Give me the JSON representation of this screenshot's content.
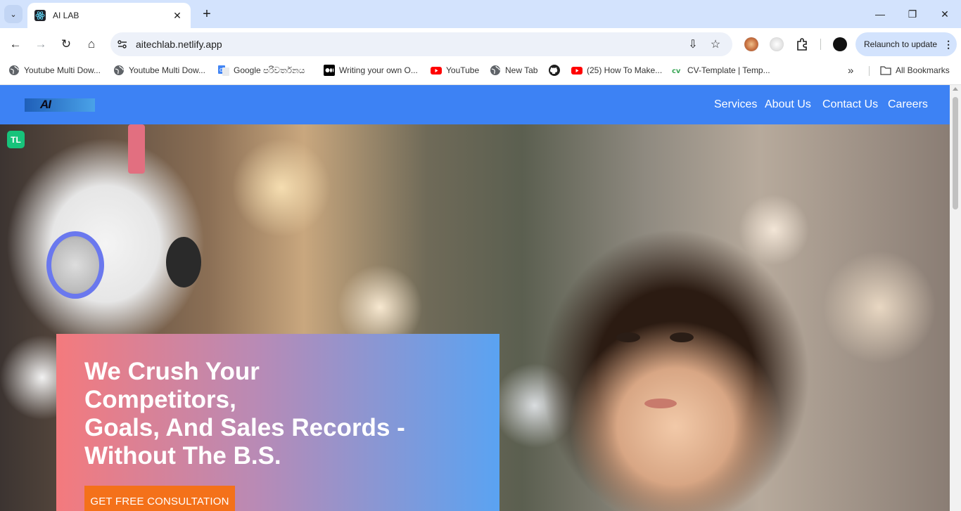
{
  "browser": {
    "tab": {
      "title": "AI LAB",
      "close_glyph": "✕",
      "favicon": "react-atom-icon"
    },
    "new_tab_glyph": "+",
    "tab_search_glyph": "⌄",
    "window": {
      "minimize": "—",
      "restore": "❐",
      "close": "✕"
    },
    "nav": {
      "back": "←",
      "forward": "→",
      "reload": "↻",
      "home": "⌂"
    },
    "address": {
      "url": "aitechlab.netlify.app"
    },
    "omnibox_icons": {
      "install": "⇩",
      "bookmark": "☆"
    },
    "relaunch": {
      "label": "Relaunch to update",
      "menu": "⋮"
    },
    "bookmarks": [
      {
        "label": "Youtube Multi Dow...",
        "icon": "globe-icon"
      },
      {
        "label": "Youtube Multi Dow...",
        "icon": "globe-icon"
      },
      {
        "label": "Google පරිවර්තනය",
        "icon": "google-translate-icon"
      },
      {
        "label": "Writing your own O...",
        "icon": "medium-icon"
      },
      {
        "label": "YouTube",
        "icon": "youtube-icon"
      },
      {
        "label": "New Tab",
        "icon": "globe-icon"
      },
      {
        "label": "",
        "icon": "github-icon"
      },
      {
        "label": "(25) How To Make...",
        "icon": "youtube-icon"
      },
      {
        "label": "CV-Template | Temp...",
        "icon": "cv-icon"
      }
    ],
    "bookmarks_overflow": "»",
    "all_bookmarks": "All Bookmarks"
  },
  "site": {
    "logo_text": "AI",
    "nav": [
      "Services",
      "About Us",
      "Contact Us",
      "Careers"
    ],
    "hero": {
      "headline_lines": [
        "We Crush Your",
        "Competitors,",
        "Goals, And Sales Records -",
        "Without The B.S."
      ],
      "cta": "GET FREE CONSULTATION"
    },
    "extension_badge": "TL"
  },
  "colors": {
    "tabstrip": "#d3e3fd",
    "navbar": "#3d82f4",
    "cta": "#f4711a",
    "card_gradient": [
      "#f47a7d",
      "#b98ab5",
      "#5aa3f2"
    ]
  }
}
